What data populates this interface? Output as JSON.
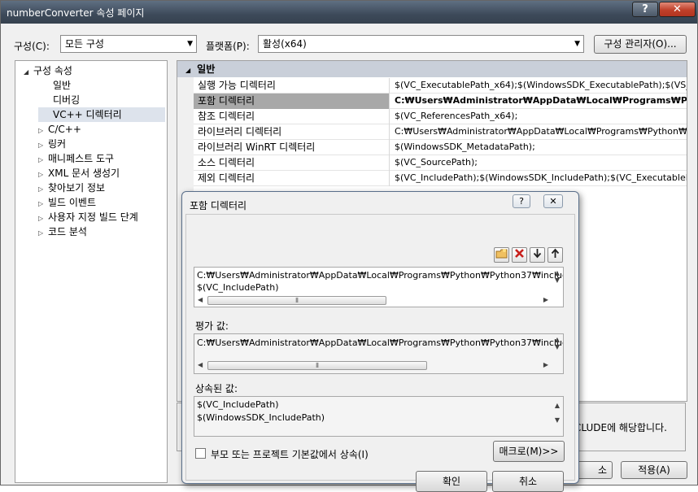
{
  "window": {
    "title": "numberConverter 속성 페이지",
    "help_glyph": "?",
    "close_glyph": "✕"
  },
  "toolbar": {
    "config_label": "구성(C):",
    "config_value": "모든 구성",
    "platform_label": "플랫폼(P):",
    "platform_value": "활성(x64)",
    "config_manager_button": "구성 관리자(O)...",
    "dropdown_glyph": "▼"
  },
  "tree": {
    "root": "구성 속성",
    "items": [
      {
        "label": "일반",
        "expandable": false
      },
      {
        "label": "디버깅",
        "expandable": false
      },
      {
        "label": "VC++ 디렉터리",
        "expandable": false,
        "selected": true
      },
      {
        "label": "C/C++",
        "expandable": true
      },
      {
        "label": "링커",
        "expandable": true
      },
      {
        "label": "매니페스트 도구",
        "expandable": true
      },
      {
        "label": "XML 문서 생성기",
        "expandable": true
      },
      {
        "label": "찾아보기 정보",
        "expandable": true
      },
      {
        "label": "빌드 이벤트",
        "expandable": true
      },
      {
        "label": "사용자 지정 빌드 단계",
        "expandable": true
      },
      {
        "label": "코드 분석",
        "expandable": true
      }
    ]
  },
  "grid": {
    "section": "일반",
    "rows": [
      {
        "name": "실행 가능 디렉터리",
        "value": "$(VC_ExecutablePath_x64);$(WindowsSDK_ExecutablePath);$(VS_Ex"
      },
      {
        "name": "포함 디렉터리",
        "value": "C:₩Users₩Administrator₩AppData₩Local₩Programs₩Python₩Pyth",
        "selected": true
      },
      {
        "name": "참조 디렉터리",
        "value": "$(VC_ReferencesPath_x64);"
      },
      {
        "name": "라이브러리 디렉터리",
        "value": "C:₩Users₩Administrator₩AppData₩Local₩Programs₩Python₩Pyth"
      },
      {
        "name": "라이브러리 WinRT 디렉터리",
        "value": "$(WindowsSDK_MetadataPath);"
      },
      {
        "name": "소스 디렉터리",
        "value": "$(VC_SourcePath);"
      },
      {
        "name": "제외 디렉터리",
        "value": "$(VC_IncludePath);$(WindowsSDK_IncludePath);$(VC_ExecutablePa"
      }
    ],
    "description_tail": "CLUDE에 해당합니다."
  },
  "footer_buttons": {
    "cancel_partial": "소",
    "apply": "적용(A)"
  },
  "dialog": {
    "title": "포함 디렉터리",
    "help_glyph": "?",
    "close_glyph": "✕",
    "icons": [
      "new-folder-icon",
      "delete-icon",
      "move-down-icon",
      "move-up-icon"
    ],
    "edit_lines": [
      "C:₩Users₩Administrator₩AppData₩Local₩Programs₩Python₩Python37₩includ",
      "$(VC_IncludePath)"
    ],
    "evaluated_label": "평가 값:",
    "evaluated_lines": [
      "C:₩Users₩Administrator₩AppData₩Local₩Programs₩Python₩Python37₩includ"
    ],
    "inherited_label": "상속된 값:",
    "inherited_lines": [
      "$(VC_IncludePath)",
      "$(WindowsSDK_IncludePath)"
    ],
    "inherit_checkbox_label": "부모 또는 프로젝트 기본값에서 상속(I)",
    "macro_button": "매크로(M)>>",
    "ok_button": "확인",
    "cancel_button": "취소"
  }
}
